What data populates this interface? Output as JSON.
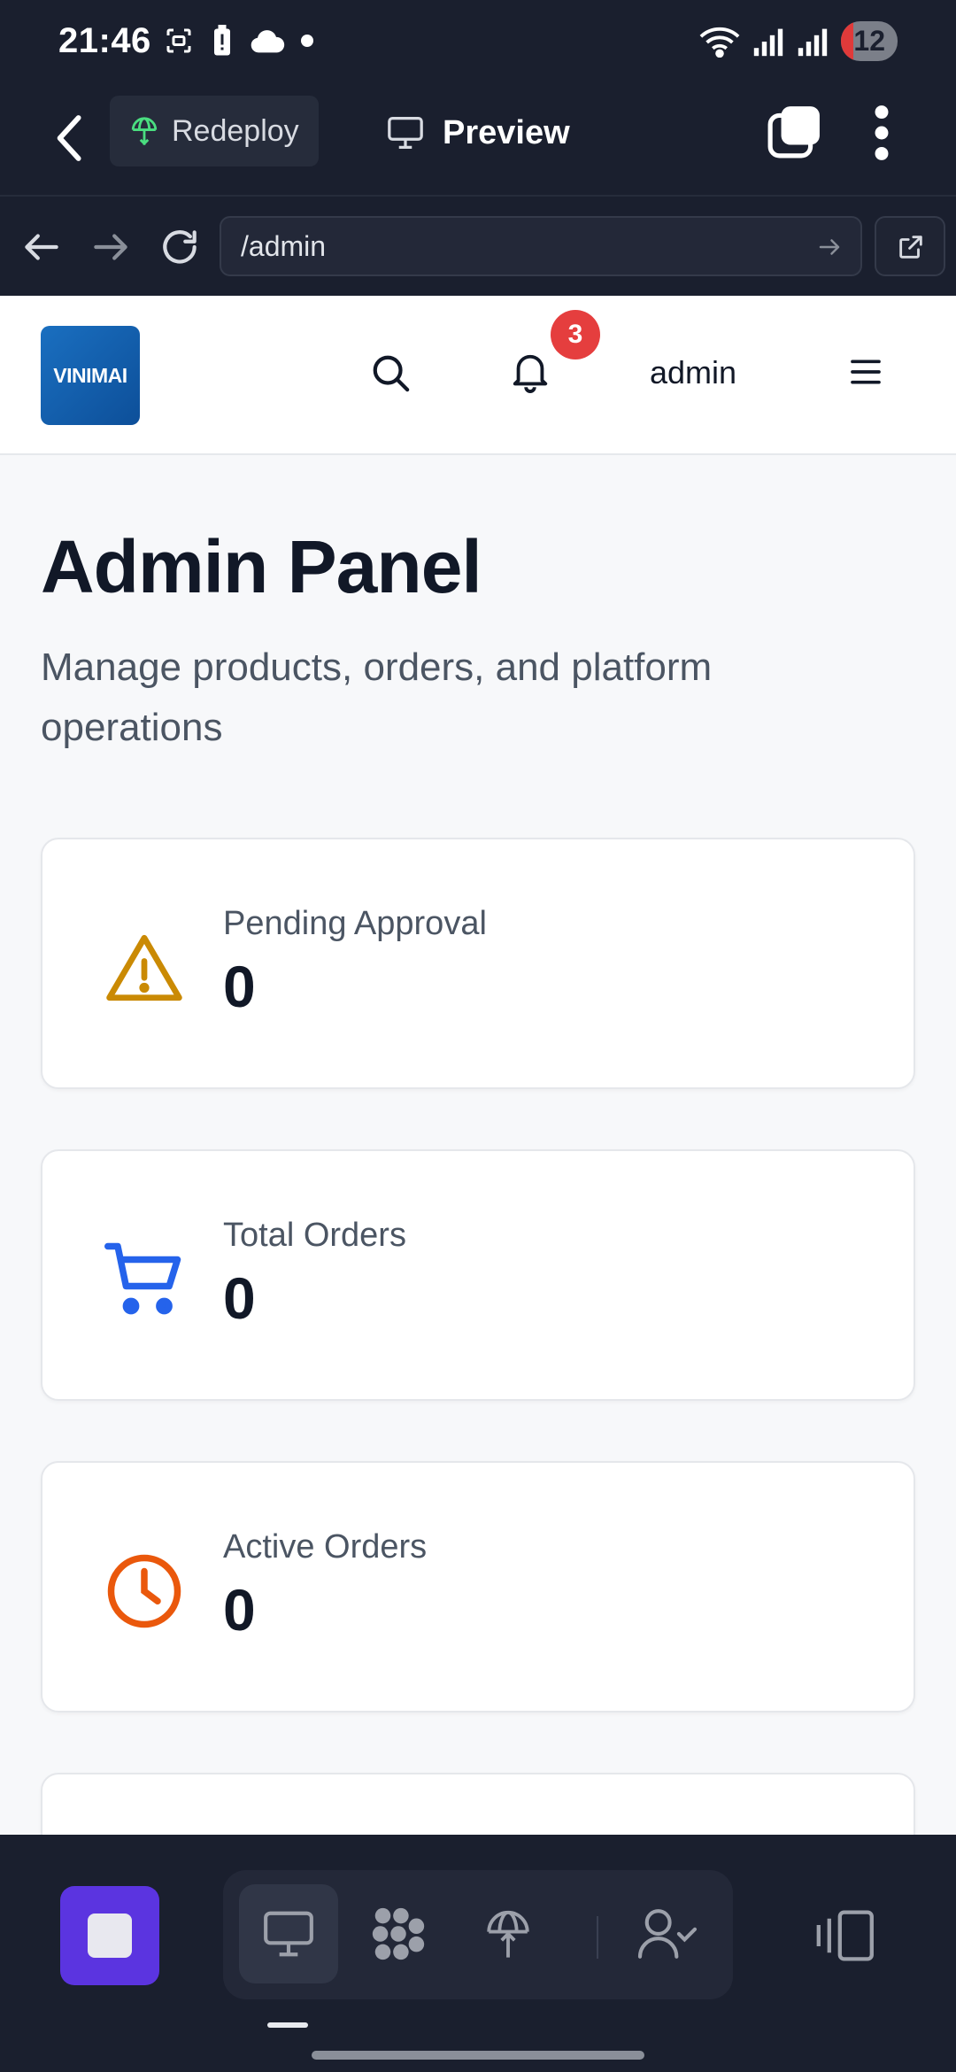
{
  "status_bar": {
    "time": "21:46",
    "battery_level": "12"
  },
  "app_bar": {
    "redeploy_label": "Redeploy",
    "preview_label": "Preview"
  },
  "browser": {
    "url": "/admin"
  },
  "site": {
    "logo_text": "VINIMAI",
    "notification_count": "3",
    "user_name": "admin"
  },
  "page": {
    "title": "Admin Panel",
    "subtitle": "Manage products, orders, and platform operations"
  },
  "stats": [
    {
      "label": "Pending Approval",
      "value": "0",
      "icon": "warning-icon",
      "color": "#ca8a04"
    },
    {
      "label": "Total Orders",
      "value": "0",
      "icon": "cart-icon",
      "color": "#2563eb"
    },
    {
      "label": "Active Orders",
      "value": "0",
      "icon": "clock-icon",
      "color": "#ea580c"
    }
  ],
  "colors": {
    "accent": "#5b34e0",
    "badge": "#e53e3e",
    "chrome": "#1a1f2e"
  }
}
